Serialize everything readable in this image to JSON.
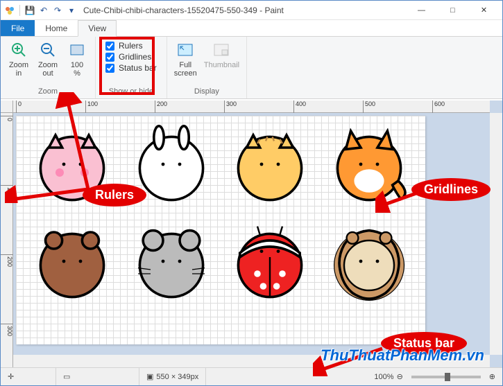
{
  "window": {
    "title": "Cute-Chibi-chibi-characters-15520475-550-349 - Paint",
    "minimize": "—",
    "maximize": "□",
    "close": "✕"
  },
  "qat": {
    "save": "💾",
    "undo": "↶",
    "redo": "↷"
  },
  "tabs": {
    "file": "File",
    "home": "Home",
    "view": "View"
  },
  "ribbon": {
    "zoom": {
      "group_label": "Zoom",
      "zoom_in": "Zoom\nin",
      "zoom_out": "Zoom\nout",
      "hundred": "100\n%"
    },
    "show_or_hide": {
      "group_label": "Show or hide",
      "rulers": "Rulers",
      "gridlines": "Gridlines",
      "status_bar": "Status bar"
    },
    "display": {
      "group_label": "Display",
      "full_screen": "Full\nscreen",
      "thumbnail": "Thumbnail"
    }
  },
  "ruler": {
    "h_ticks": [
      "0",
      "100",
      "200",
      "300",
      "400",
      "500",
      "600"
    ],
    "v_ticks": [
      "0",
      "100",
      "200",
      "300"
    ]
  },
  "status": {
    "cursor_pos": "",
    "selection_size": "",
    "canvas_size": "550 × 349px",
    "zoom_level": "100%",
    "zoom_minus": "⊖",
    "zoom_plus": "⊕"
  },
  "annotations": {
    "rulers_label": "Rulers",
    "gridlines_label": "Gridlines",
    "status_bar_label": "Status bar",
    "watermark": "ThuThuatPhanMem.vn"
  },
  "colors": {
    "accent": "#1979ca",
    "highlight": "#e30000",
    "canvas_bg": "#c9d7e9"
  }
}
